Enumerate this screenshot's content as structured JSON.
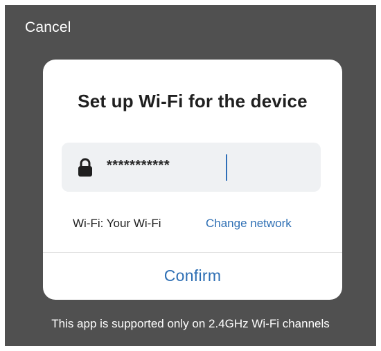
{
  "header": {
    "cancel_label": "Cancel"
  },
  "dialog": {
    "title": "Set up Wi-Fi for the device",
    "password_field": {
      "value": "***********",
      "icon": "lock-icon"
    },
    "wifi_label": "Wi-Fi: Your Wi-Fi",
    "change_network_label": "Change network",
    "confirm_label": "Confirm"
  },
  "footer": {
    "note": "This app is supported only on 2.4GHz Wi-Fi channels"
  },
  "colors": {
    "backdrop": "#505050",
    "accent": "#2e6fb4",
    "field_background": "#eff1f3"
  }
}
